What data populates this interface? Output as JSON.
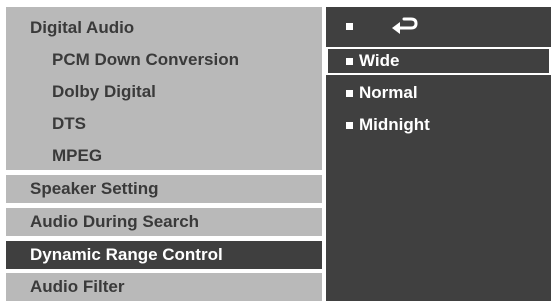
{
  "left_menu": {
    "digital_audio": {
      "label": "Digital Audio",
      "subitems": [
        {
          "label": "PCM Down Conversion"
        },
        {
          "label": "Dolby Digital"
        },
        {
          "label": "DTS"
        },
        {
          "label": "MPEG"
        }
      ]
    },
    "items": [
      {
        "label": "Speaker Setting",
        "selected": false
      },
      {
        "label": "Audio  During Search",
        "selected": false
      },
      {
        "label": "Dynamic Range Control",
        "selected": true
      },
      {
        "label": "Audio Filter",
        "selected": false
      }
    ]
  },
  "options_panel": {
    "return_icon": "return-arrow-icon",
    "options": [
      {
        "label": "Wide",
        "highlighted": true
      },
      {
        "label": "Normal",
        "highlighted": false
      },
      {
        "label": "Midnight",
        "highlighted": false
      }
    ]
  },
  "colors": {
    "menu_background": "#b9b9b9",
    "menu_selected": "#3f3f3f",
    "panel_background": "#404040",
    "text_dark": "#3a3a3a",
    "text_light": "#ffffff"
  }
}
